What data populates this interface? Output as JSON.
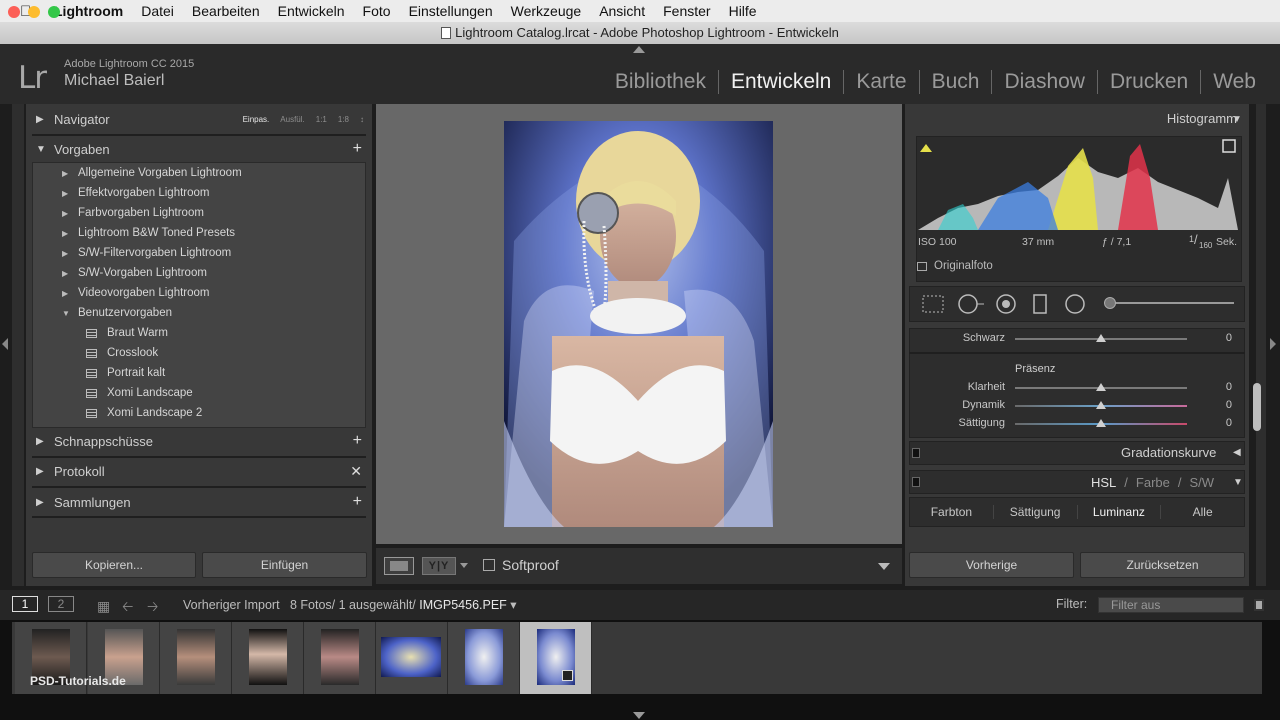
{
  "menubar": {
    "app": "Lightroom",
    "items": [
      "Datei",
      "Bearbeiten",
      "Entwickeln",
      "Foto",
      "Einstellungen",
      "Werkzeuge",
      "Ansicht",
      "Fenster",
      "Hilfe"
    ]
  },
  "window": {
    "title": "Lightroom Catalog.lrcat - Adobe Photoshop Lightroom - Entwickeln"
  },
  "identity": {
    "logo": "Lr",
    "product": "Adobe Lightroom CC 2015",
    "user": "Michael Baierl"
  },
  "modules": [
    "Bibliothek",
    "Entwickeln",
    "Karte",
    "Buch",
    "Diashow",
    "Drucken",
    "Web"
  ],
  "active_module": "Entwickeln",
  "left_panel": {
    "navigator": {
      "title": "Navigator",
      "zoom": [
        "Einpas.",
        "Ausfül.",
        "1:1",
        "1:8"
      ]
    },
    "presets": {
      "title": "Vorgaben",
      "folders": [
        "Allgemeine Vorgaben Lightroom",
        "Effektvorgaben Lightroom",
        "Farbvorgaben Lightroom",
        "Lightroom B&W Toned Presets",
        "S/W-Filtervorgaben Lightroom",
        "S/W-Vorgaben Lightroom",
        "Videovorgaben Lightroom",
        "Benutzervorgaben"
      ],
      "user_presets": [
        "Braut Warm",
        "Crosslook",
        "Portrait kalt",
        "Xomi Landscape",
        "Xomi Landscape 2"
      ]
    },
    "snapshots": "Schnappschüsse",
    "history": "Protokoll",
    "collections": "Sammlungen",
    "copy_button": "Kopieren...",
    "paste_button": "Einfügen"
  },
  "toolbar": {
    "softproof": "Softproof",
    "compare_glyph": "Y|Y"
  },
  "right_panel": {
    "histogram": {
      "title": "Histogramm",
      "iso": "ISO 100",
      "focal": "37 mm",
      "aperture": "ƒ / 7,1",
      "shutter_num": "1",
      "shutter_den": "160",
      "shutter_unit": "Sek.",
      "original": "Originalfoto"
    },
    "sliders": [
      {
        "label": "Schwarz",
        "value": "0"
      },
      {
        "label": "Klarheit",
        "value": "0"
      },
      {
        "label": "Dynamik",
        "value": "0"
      },
      {
        "label": "Sättigung",
        "value": "0"
      }
    ],
    "presence_title": "Präsenz",
    "tone_curve": "Gradationskurve",
    "hsl": {
      "hsl": "HSL",
      "color": "Farbe",
      "bw": "S/W",
      "slash": "/"
    },
    "hsl_tabs": [
      "Farbton",
      "Sättigung",
      "Luminanz",
      "Alle"
    ],
    "active_hsl_tab": "Luminanz",
    "prev_button": "Vorherige",
    "reset_button": "Zurücksetzen"
  },
  "filmstrip": {
    "screen1": "1",
    "screen2": "2",
    "source": "Vorheriger Import",
    "count": "8 Fotos/ 1 ausgewählt/",
    "current_file": "IMGP5456.PEF",
    "filter_label": "Filter:",
    "filter_value": "Filter aus",
    "thumbnail_count": 8,
    "selected_index": 7,
    "watermark": "PSD-Tutorials.de"
  },
  "colors": {
    "accent_active": "#f0f0f0",
    "panel": "#383838",
    "selected_thumb": "#bfbfbf"
  }
}
